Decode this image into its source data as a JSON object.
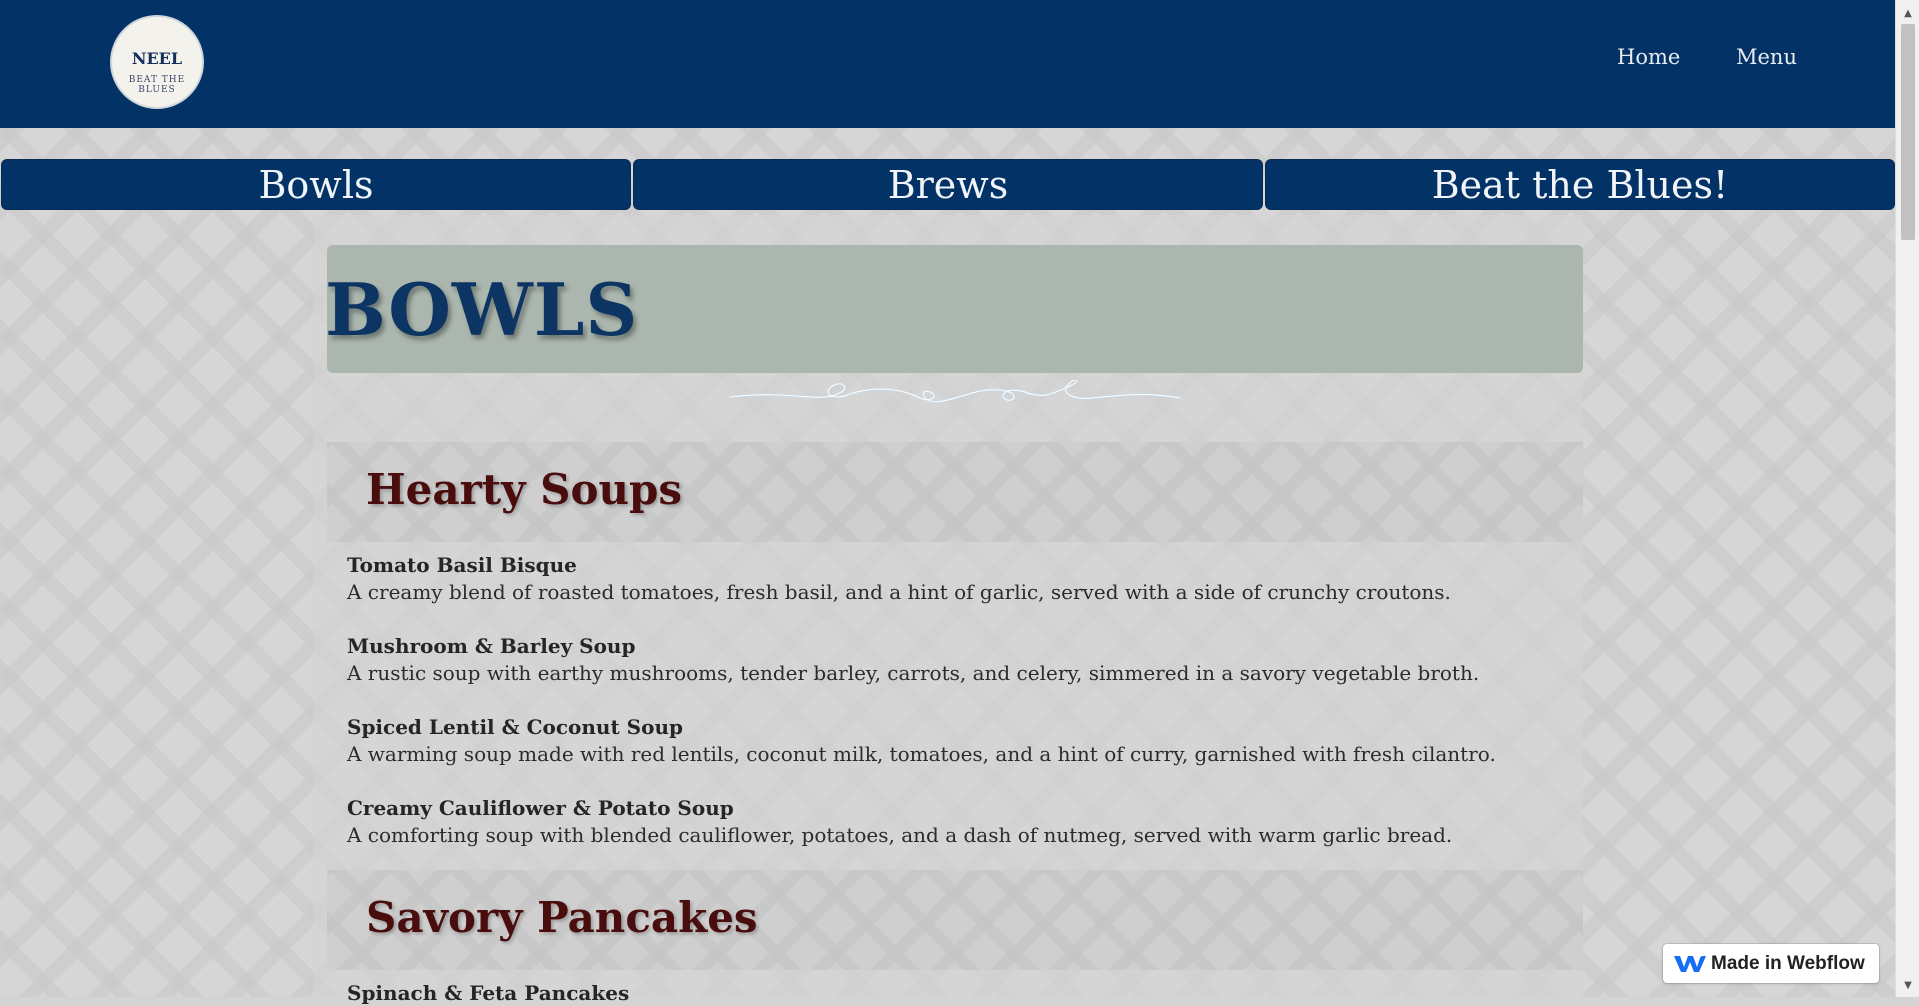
{
  "brand": {
    "logo_name": "NEEL",
    "logo_tagline": "BEAT THE BLUES"
  },
  "nav": {
    "home": "Home",
    "menu": "Menu"
  },
  "tabs": [
    {
      "label": "Bowls"
    },
    {
      "label": "Brews"
    },
    {
      "label": "Beat the Blues!"
    }
  ],
  "page": {
    "title": "BOWLS"
  },
  "sections": [
    {
      "heading": "Hearty Soups",
      "items": [
        {
          "name": "Tomato Basil Bisque",
          "description": "A creamy blend of roasted tomatoes, fresh basil, and a hint of garlic, served with a side of crunchy croutons."
        },
        {
          "name": "Mushroom & Barley Soup",
          "description": "A rustic soup with earthy mushrooms, tender barley, carrots, and celery, simmered in a savory vegetable broth."
        },
        {
          "name": "Spiced Lentil & Coconut Soup",
          "description": "A warming soup made with red lentils, coconut milk, tomatoes, and a hint of curry, garnished with fresh cilantro."
        },
        {
          "name": "Creamy Cauliflower & Potato Soup",
          "description": "A comforting soup with blended cauliflower, potatoes, and a dash of nutmeg, served with warm garlic bread."
        }
      ]
    },
    {
      "heading": "Savory Pancakes",
      "items": [
        {
          "name": "Spinach & Feta Pancakes"
        }
      ]
    }
  ],
  "badge": {
    "label": "Made in Webflow"
  },
  "colors": {
    "navy": "#033366",
    "title_box": "#abb7ae",
    "heading_maroon": "#4a0d0d"
  }
}
